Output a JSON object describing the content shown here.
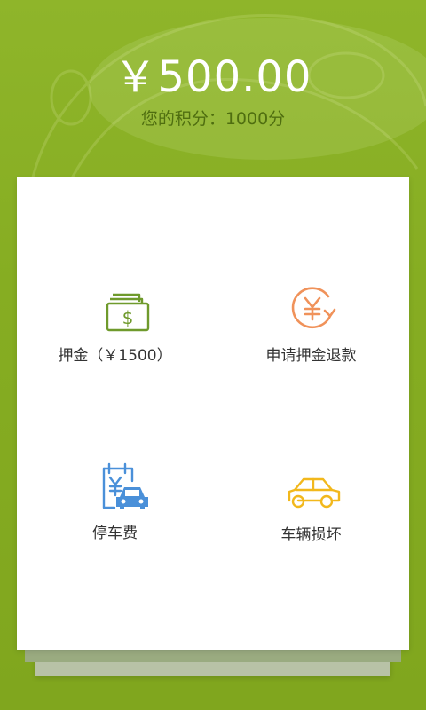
{
  "balance": "￥500.00",
  "points_text": "您的积分：1000分",
  "menu": [
    {
      "label": "押金（￥1500）",
      "icon": "money-stack-icon",
      "color": "#6f9a2c"
    },
    {
      "label": "申请押金退款",
      "icon": "yuan-refund-icon",
      "color": "#f0925a"
    },
    {
      "label": "停车费",
      "icon": "parking-fee-icon",
      "color": "#4a90d9"
    },
    {
      "label": "车辆损坏",
      "icon": "car-damage-icon",
      "color": "#f2b81c"
    }
  ]
}
